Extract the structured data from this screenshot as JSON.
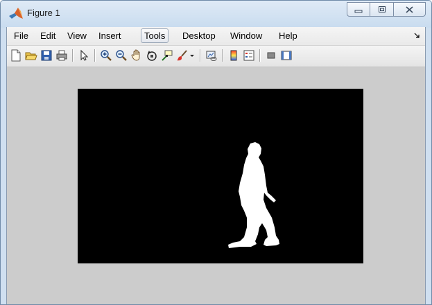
{
  "window": {
    "title": "Figure 1",
    "caption_buttons": [
      "minimize",
      "restore",
      "close"
    ]
  },
  "menubar": {
    "items": [
      "File",
      "Edit",
      "View",
      "Insert",
      "Tools",
      "Desktop",
      "Window",
      "Help"
    ],
    "active": "Tools"
  },
  "toolbar": {
    "buttons": [
      "new-figure-icon",
      "open-file-icon",
      "save-icon",
      "print-icon",
      "pointer-icon",
      "zoom-in-icon",
      "zoom-out-icon",
      "pan-icon",
      "rotate-3d-icon",
      "data-cursor-icon",
      "brush-icon",
      "brush-dropdown-icon",
      "link-plot-icon",
      "insert-colorbar-icon",
      "insert-legend-icon",
      "hide-plot-tools-icon",
      "show-plot-tools-icon"
    ]
  },
  "figure": {
    "background": "#cccccc",
    "axes_background": "#000000",
    "silhouette_color": "#ffffff"
  }
}
